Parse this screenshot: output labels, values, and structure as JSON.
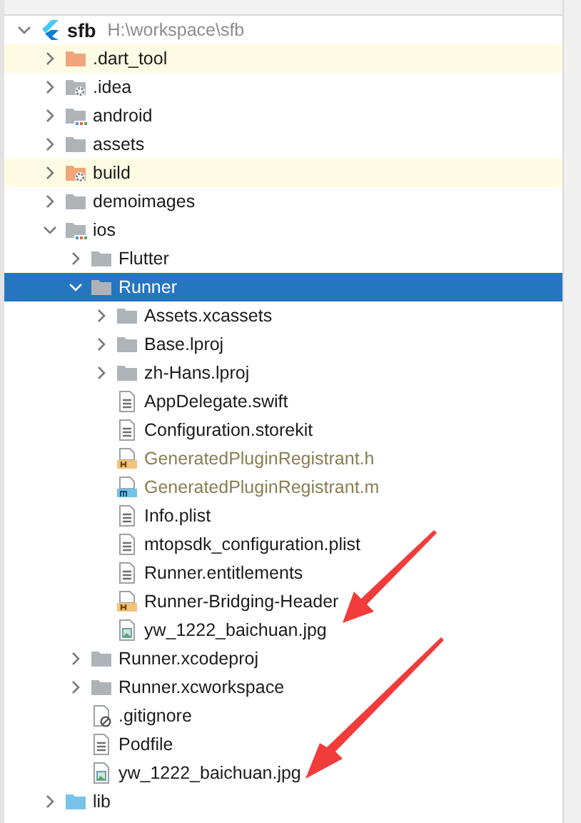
{
  "project_tree": {
    "root": {
      "name": "sfb",
      "path": "H:\\workspace\\sfb",
      "kind": "flutter",
      "expanded": true,
      "selected": false,
      "children": [
        {
          "name": ".dart_tool",
          "kind": "excluded",
          "expanded": false,
          "excluded": true,
          "selected": false
        },
        {
          "name": ".idea",
          "kind": "config",
          "expanded": false,
          "excluded": false,
          "selected": false
        },
        {
          "name": "android",
          "kind": "module",
          "expanded": false,
          "excluded": false,
          "selected": false
        },
        {
          "name": "assets",
          "kind": "folder",
          "expanded": false,
          "excluded": false,
          "selected": false
        },
        {
          "name": "build",
          "kind": "excludedconfig",
          "expanded": false,
          "excluded": true,
          "selected": false
        },
        {
          "name": "demoimages",
          "kind": "folder",
          "expanded": false,
          "excluded": false,
          "selected": false
        },
        {
          "name": "ios",
          "kind": "module",
          "expanded": true,
          "excluded": false,
          "selected": false,
          "children": [
            {
              "name": "Flutter",
              "kind": "folder",
              "expanded": false,
              "excluded": false,
              "selected": false
            },
            {
              "name": "Runner",
              "kind": "folder",
              "expanded": true,
              "excluded": false,
              "selected": true,
              "children": [
                {
                  "name": "Assets.xcassets",
                  "kind": "folder",
                  "expanded": false,
                  "excluded": false,
                  "selected": false
                },
                {
                  "name": "Base.lproj",
                  "kind": "folder",
                  "expanded": false,
                  "excluded": false,
                  "selected": false
                },
                {
                  "name": "zh-Hans.lproj",
                  "kind": "folder",
                  "expanded": false,
                  "excluded": false,
                  "selected": false
                },
                {
                  "name": "AppDelegate.swift",
                  "kind": "text",
                  "generated": false,
                  "selected": false
                },
                {
                  "name": "Configuration.storekit",
                  "kind": "text",
                  "generated": false,
                  "selected": false
                },
                {
                  "name": "GeneratedPluginRegistrant.h",
                  "kind": "header",
                  "generated": true,
                  "selected": false
                },
                {
                  "name": "GeneratedPluginRegistrant.m",
                  "kind": "source",
                  "generated": true,
                  "selected": false
                },
                {
                  "name": "Info.plist",
                  "kind": "text",
                  "generated": false,
                  "selected": false
                },
                {
                  "name": "mtopsdk_configuration.plist",
                  "kind": "text",
                  "generated": false,
                  "selected": false
                },
                {
                  "name": "Runner.entitlements",
                  "kind": "text",
                  "generated": false,
                  "selected": false
                },
                {
                  "name": "Runner-Bridging-Header",
                  "kind": "header",
                  "generated": false,
                  "selected": false
                },
                {
                  "name": "yw_1222_baichuan.jpg",
                  "kind": "image",
                  "generated": false,
                  "selected": false
                }
              ]
            },
            {
              "name": "Runner.xcodeproj",
              "kind": "folder",
              "expanded": false,
              "excluded": false,
              "selected": false
            },
            {
              "name": "Runner.xcworkspace",
              "kind": "folder",
              "expanded": false,
              "excluded": false,
              "selected": false
            },
            {
              "name": ".gitignore",
              "kind": "ignored",
              "generated": false,
              "selected": false
            },
            {
              "name": "Podfile",
              "kind": "text",
              "generated": false,
              "selected": false
            },
            {
              "name": "yw_1222_baichuan.jpg",
              "kind": "image",
              "generated": false,
              "selected": false
            }
          ]
        },
        {
          "name": "lib",
          "kind": "source-folder",
          "expanded": false,
          "excluded": false,
          "selected": false
        }
      ]
    }
  }
}
